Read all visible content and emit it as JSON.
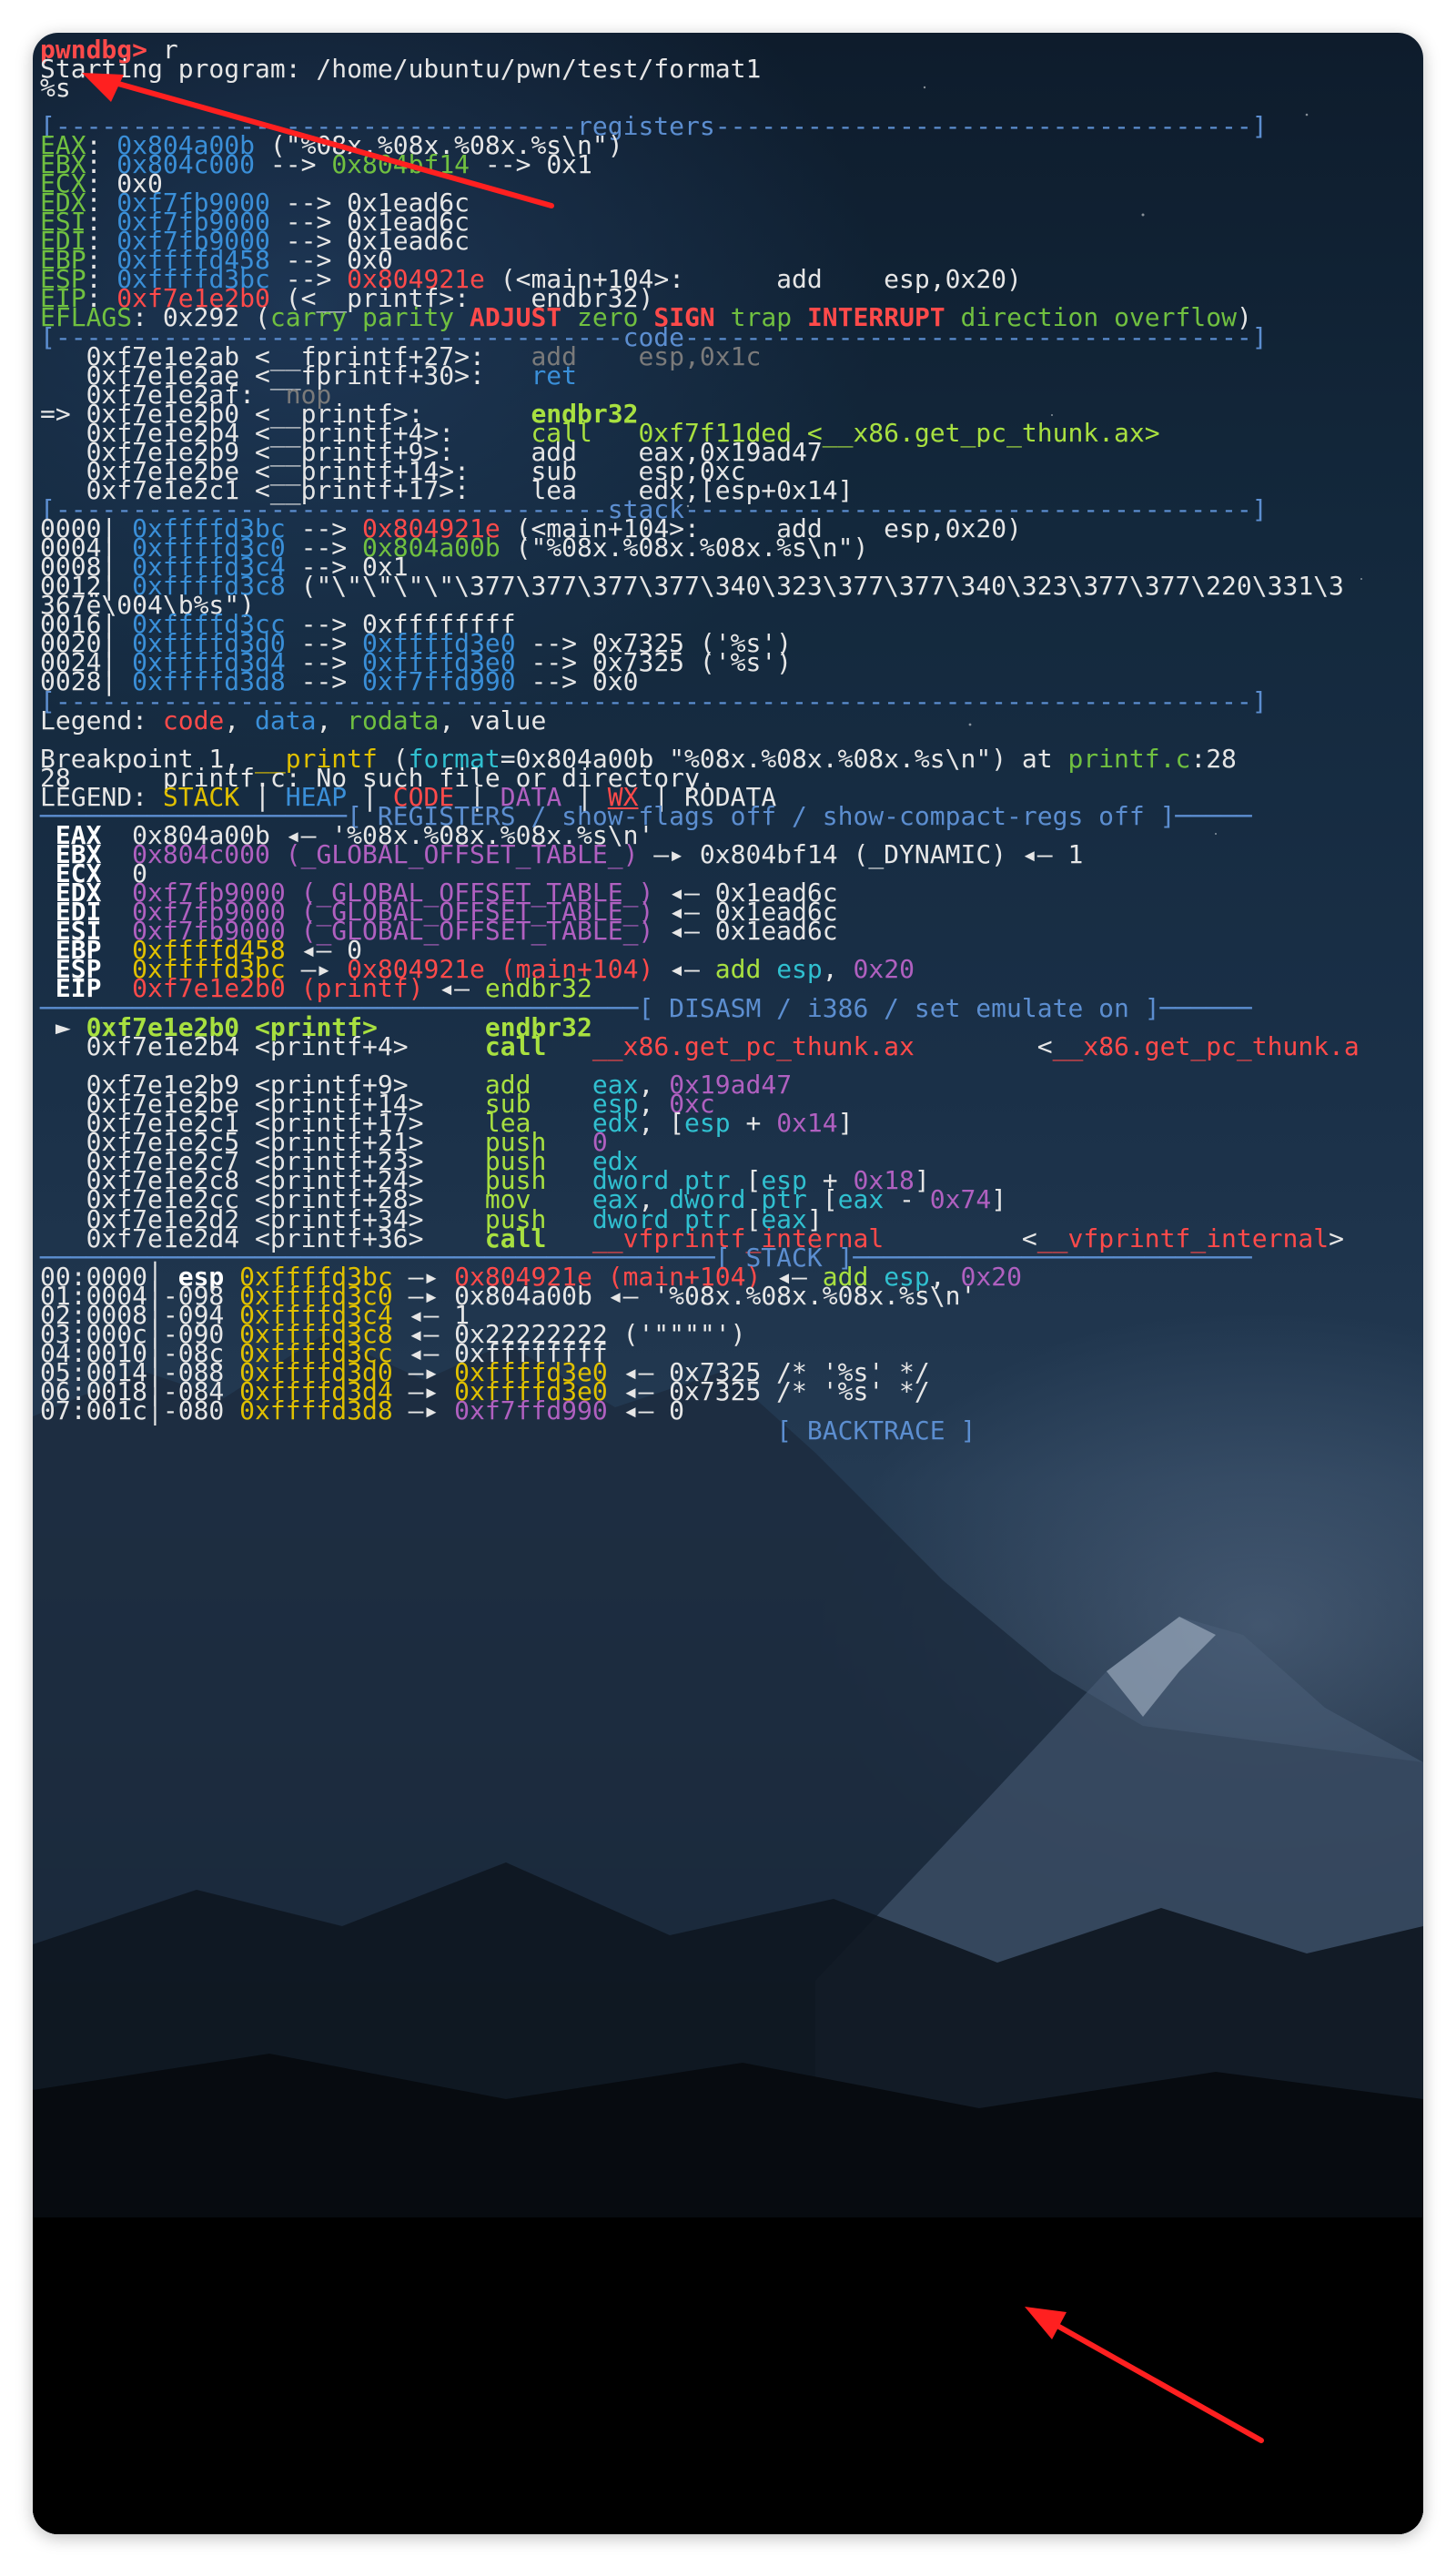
{
  "terminal": {
    "prompt": "pwndbg>",
    "command": " r",
    "starting": "Starting program: /home/ubuntu/pwn/test/format1",
    "input": "%s"
  },
  "peda": {
    "registers_header": "[----------------------------------registers-----------------------------------]",
    "registers": [
      [
        [
          "EAX",
          "g"
        ],
        [
          ": ",
          "w"
        ],
        [
          "0x804a00b",
          "b"
        ],
        [
          " (\"%08x.%08x.%08x.%s\\n\")",
          "w"
        ]
      ],
      [
        [
          "EBX",
          "g"
        ],
        [
          ": ",
          "w"
        ],
        [
          "0x804c000",
          "b"
        ],
        [
          " --> ",
          "w"
        ],
        [
          "0x804bf14",
          "g"
        ],
        [
          " --> 0x1",
          "w"
        ]
      ],
      [
        [
          "ECX",
          "g"
        ],
        [
          ": 0x0",
          "w"
        ]
      ],
      [
        [
          "EDX",
          "g"
        ],
        [
          ": ",
          "w"
        ],
        [
          "0xf7fb9000",
          "b"
        ],
        [
          " --> 0x1ead6c",
          "w"
        ]
      ],
      [
        [
          "ESI",
          "g"
        ],
        [
          ": ",
          "w"
        ],
        [
          "0xf7fb9000",
          "b"
        ],
        [
          " --> 0x1ead6c",
          "w"
        ]
      ],
      [
        [
          "EDI",
          "g"
        ],
        [
          ": ",
          "w"
        ],
        [
          "0xf7fb9000",
          "b"
        ],
        [
          " --> 0x1ead6c",
          "w"
        ]
      ],
      [
        [
          "EBP",
          "g"
        ],
        [
          ": ",
          "w"
        ],
        [
          "0xffffd458",
          "b"
        ],
        [
          " --> 0x0",
          "w"
        ]
      ],
      [
        [
          "ESP",
          "g"
        ],
        [
          ": ",
          "w"
        ],
        [
          "0xffffd3bc",
          "b"
        ],
        [
          " --> ",
          "w"
        ],
        [
          "0x804921e",
          "r"
        ],
        [
          " (<main+104>:      add    esp,0x20)",
          "w"
        ]
      ],
      [
        [
          "EIP",
          "g"
        ],
        [
          ": ",
          "w"
        ],
        [
          "0xf7e1e2b0",
          "r"
        ],
        [
          " (<__printf>:    endbr32)",
          "w"
        ]
      ],
      [
        [
          "EFLAGS",
          "g"
        ],
        [
          ": 0x292 (",
          "w"
        ],
        [
          "carry parity ",
          "g"
        ],
        [
          "ADJUST",
          "rb"
        ],
        [
          " zero ",
          "g"
        ],
        [
          "SIGN",
          "rb"
        ],
        [
          " trap ",
          "g"
        ],
        [
          "INTERRUPT",
          "rb"
        ],
        [
          " direction overflow",
          "g"
        ],
        [
          ")",
          "w"
        ]
      ]
    ],
    "code_header": "[-------------------------------------code-------------------------------------]",
    "code": [
      [
        [
          "   0xf7e1e2ab <__fprintf+27>:   ",
          "w"
        ],
        [
          "add    esp,0x1c",
          "gr"
        ]
      ],
      [
        [
          "   0xf7e1e2ae <__fprintf+30>:   ",
          "w"
        ],
        [
          "ret",
          "b"
        ]
      ],
      [
        [
          "   0xf7e1e2af:  ",
          "w"
        ],
        [
          "nop",
          "gr"
        ]
      ],
      [
        [
          "=> 0xf7e1e2b0 <__printf>:       ",
          "w"
        ],
        [
          "endbr32",
          "gb"
        ]
      ],
      [
        [
          "   0xf7e1e2b4 <__printf+4>:     ",
          "w"
        ],
        [
          "call   0xf7f11ded <__x86.get_pc_thunk.ax>",
          "gy"
        ]
      ],
      [
        [
          "   0xf7e1e2b9 <__printf+9>:     add    eax,0x19ad47",
          "w"
        ]
      ],
      [
        [
          "   0xf7e1e2be <__printf+14>:    sub    esp,0xc",
          "w"
        ]
      ],
      [
        [
          "   0xf7e1e2c1 <__printf+17>:    lea    edx,[esp+0x14]",
          "w"
        ]
      ]
    ],
    "stack_header": "[------------------------------------stack-------------------------------------]",
    "stack": [
      [
        [
          "0000| ",
          "w"
        ],
        [
          "0xffffd3bc",
          "b"
        ],
        [
          " --> ",
          "w"
        ],
        [
          "0x804921e",
          "r"
        ],
        [
          " (<main+104>:     add    esp,0x20)",
          "w"
        ]
      ],
      [
        [
          "0004| ",
          "w"
        ],
        [
          "0xffffd3c0",
          "b"
        ],
        [
          " --> ",
          "w"
        ],
        [
          "0x804a00b",
          "g"
        ],
        [
          " (\"%08x.%08x.%08x.%s\\n\")",
          "w"
        ]
      ],
      [
        [
          "0008| ",
          "w"
        ],
        [
          "0xffffd3c4",
          "b"
        ],
        [
          " --> 0x1",
          "w"
        ]
      ],
      [
        [
          "0012| ",
          "w"
        ],
        [
          "0xffffd3c8",
          "b"
        ],
        [
          " (\"\\\"\\\"\\\"\\\"\\377\\377\\377\\377\\340\\323\\377\\377\\340\\323\\377\\377\\220\\331\\3",
          "w"
        ]
      ],
      [
        [
          "367ë\\004\\b%s\")",
          "w"
        ]
      ],
      [
        [
          "0016| ",
          "w"
        ],
        [
          "0xffffd3cc",
          "b"
        ],
        [
          " --> 0xffffffff",
          "w"
        ]
      ],
      [
        [
          "0020| ",
          "w"
        ],
        [
          "0xffffd3d0",
          "b"
        ],
        [
          " --> ",
          "w"
        ],
        [
          "0xffffd3e0",
          "b"
        ],
        [
          " --> 0x7325 ('%s')",
          "w"
        ]
      ],
      [
        [
          "0024| ",
          "w"
        ],
        [
          "0xffffd3d4",
          "b"
        ],
        [
          " --> ",
          "w"
        ],
        [
          "0xffffd3e0",
          "b"
        ],
        [
          " --> 0x7325 ('%s')",
          "w"
        ]
      ],
      [
        [
          "0028| ",
          "w"
        ],
        [
          "0xffffd3d8",
          "b"
        ],
        [
          " --> ",
          "w"
        ],
        [
          "0xf7ffd990",
          "b"
        ],
        [
          " --> 0x0",
          "w"
        ]
      ]
    ],
    "footer": "[------------------------------------------------------------------------------]",
    "legend": [
      [
        "Legend: ",
        "w"
      ],
      [
        "code",
        "r"
      ],
      [
        ", ",
        "w"
      ],
      [
        "data",
        "b"
      ],
      [
        ", ",
        "w"
      ],
      [
        "rodata",
        "g"
      ],
      [
        ", value",
        "w"
      ]
    ]
  },
  "breakpoint": [
    [
      [
        "Breakpoint 1, ",
        "w"
      ],
      [
        "__printf",
        "y"
      ],
      [
        " (",
        "w"
      ],
      [
        "format",
        "c"
      ],
      [
        "=0x804a00b \"%08x.%08x.%08x.%s\\n\") at ",
        "w"
      ],
      [
        "printf.c",
        "g"
      ],
      [
        ":28",
        "w"
      ]
    ],
    [
      [
        "28      printf.c: No such file or directory.",
        "w"
      ]
    ],
    [
      [
        "LEGEND: ",
        "w"
      ],
      [
        "STACK",
        "y"
      ],
      [
        " | ",
        "w"
      ],
      [
        "HEAP",
        "b"
      ],
      [
        " | ",
        "w"
      ],
      [
        "CODE",
        "r"
      ],
      [
        " | ",
        "w"
      ],
      [
        "DATA",
        "m"
      ],
      [
        " | ",
        "w"
      ],
      [
        "WX",
        "ru"
      ],
      [
        " | RODATA",
        "w"
      ]
    ]
  ],
  "pwndbg": {
    "registers_header": "────────────────────[ REGISTERS / show-flags off / show-compact-regs off ]─────",
    "registers": [
      [
        [
          " EAX  ",
          "wb"
        ],
        [
          "0x804a00b ◂— '%08x.%08x.%08x.%s\\n'",
          "w"
        ]
      ],
      [
        [
          " EBX  ",
          "wb"
        ],
        [
          "0x804c000 (_GLOBAL_OFFSET_TABLE_)",
          "m"
        ],
        [
          " —▸ 0x804bf14 (_DYNAMIC) ◂— 1",
          "w"
        ]
      ],
      [
        [
          " ECX  ",
          "wb"
        ],
        [
          "0",
          "w"
        ]
      ],
      [
        [
          " EDX  ",
          "wb"
        ],
        [
          "0xf7fb9000 (_GLOBAL_OFFSET_TABLE_)",
          "m"
        ],
        [
          " ◂— 0x1ead6c",
          "w"
        ]
      ],
      [
        [
          " EDI  ",
          "wb"
        ],
        [
          "0xf7fb9000 (_GLOBAL_OFFSET_TABLE_)",
          "m"
        ],
        [
          " ◂— 0x1ead6c",
          "w"
        ]
      ],
      [
        [
          " ESI  ",
          "wb"
        ],
        [
          "0xf7fb9000 (_GLOBAL_OFFSET_TABLE_)",
          "m"
        ],
        [
          " ◂— 0x1ead6c",
          "w"
        ]
      ],
      [
        [
          " EBP  ",
          "wb"
        ],
        [
          "0xffffd458",
          "y"
        ],
        [
          " ◂— 0",
          "w"
        ]
      ],
      [
        [
          " ESP  ",
          "wb"
        ],
        [
          "0xffffd3bc",
          "y"
        ],
        [
          " —▸ ",
          "w"
        ],
        [
          "0x804921e (main+104)",
          "r"
        ],
        [
          " ◂— ",
          "w"
        ],
        [
          "add ",
          "gy"
        ],
        [
          "esp",
          "c"
        ],
        [
          ", ",
          "w"
        ],
        [
          "0x20",
          "m"
        ]
      ],
      [
        [
          " EIP  ",
          "wb"
        ],
        [
          "0xf7e1e2b0 (printf)",
          "r"
        ],
        [
          " ◂— ",
          "w"
        ],
        [
          "endbr32",
          "gy"
        ]
      ]
    ],
    "disasm_header": "───────────────────────────────────────[ DISASM / i386 / set emulate on ]──────",
    "disasm": [
      [
        [
          " ► ",
          "w"
        ],
        [
          "0xf7e1e2b0 <printf>       ",
          "gb"
        ],
        [
          "endbr32",
          "gb"
        ]
      ],
      [
        [
          "   0xf7e1e2b4 <printf+4>     ",
          "w"
        ],
        [
          "call",
          "gb"
        ],
        [
          "   ",
          "w"
        ],
        [
          "__x86.get_pc_thunk.ax",
          "r"
        ],
        [
          "        <",
          "w"
        ],
        [
          "__x86.get_pc_thunk.a",
          "r"
        ]
      ],
      [
        [
          "",
          "w"
        ]
      ],
      [
        [
          "   0xf7e1e2b9 <printf+9>     ",
          "w"
        ],
        [
          "add",
          "gy"
        ],
        [
          "    ",
          "w"
        ],
        [
          "eax",
          "c"
        ],
        [
          ", ",
          "w"
        ],
        [
          "0x19ad47",
          "m"
        ]
      ],
      [
        [
          "   0xf7e1e2be <printf+14>    ",
          "w"
        ],
        [
          "sub",
          "gy"
        ],
        [
          "    ",
          "w"
        ],
        [
          "esp",
          "c"
        ],
        [
          ", ",
          "w"
        ],
        [
          "0xc",
          "m"
        ]
      ],
      [
        [
          "   0xf7e1e2c1 <printf+17>    ",
          "w"
        ],
        [
          "lea",
          "gy"
        ],
        [
          "    ",
          "w"
        ],
        [
          "edx",
          "c"
        ],
        [
          ", [",
          "w"
        ],
        [
          "esp",
          "c"
        ],
        [
          " + ",
          "w"
        ],
        [
          "0x14",
          "m"
        ],
        [
          "]",
          "w"
        ]
      ],
      [
        [
          "   0xf7e1e2c5 <printf+21>    ",
          "w"
        ],
        [
          "push",
          "gy"
        ],
        [
          "   ",
          "w"
        ],
        [
          "0",
          "m"
        ]
      ],
      [
        [
          "   0xf7e1e2c7 <printf+23>    ",
          "w"
        ],
        [
          "push",
          "gy"
        ],
        [
          "   ",
          "w"
        ],
        [
          "edx",
          "c"
        ]
      ],
      [
        [
          "   0xf7e1e2c8 <printf+24>    ",
          "w"
        ],
        [
          "push",
          "gy"
        ],
        [
          "   ",
          "w"
        ],
        [
          "dword ptr",
          "c"
        ],
        [
          " [",
          "w"
        ],
        [
          "esp",
          "c"
        ],
        [
          " + ",
          "w"
        ],
        [
          "0x18",
          "m"
        ],
        [
          "]",
          "w"
        ]
      ],
      [
        [
          "   0xf7e1e2cc <printf+28>    ",
          "w"
        ],
        [
          "mov",
          "gy"
        ],
        [
          "    ",
          "w"
        ],
        [
          "eax",
          "c"
        ],
        [
          ", ",
          "w"
        ],
        [
          "dword ptr",
          "c"
        ],
        [
          " [",
          "w"
        ],
        [
          "eax",
          "c"
        ],
        [
          " - ",
          "w"
        ],
        [
          "0x74",
          "m"
        ],
        [
          "]",
          "w"
        ]
      ],
      [
        [
          "   0xf7e1e2d2 <printf+34>    ",
          "w"
        ],
        [
          "push",
          "gy"
        ],
        [
          "   ",
          "w"
        ],
        [
          "dword ptr",
          "c"
        ],
        [
          " [",
          "w"
        ],
        [
          "eax",
          "c"
        ],
        [
          "]",
          "w"
        ]
      ],
      [
        [
          "   0xf7e1e2d4 <printf+36>    ",
          "w"
        ],
        [
          "call",
          "gb"
        ],
        [
          "   ",
          "w"
        ],
        [
          "__vfprintf_internal",
          "r"
        ],
        [
          "         <",
          "w"
        ],
        [
          "__vfprintf_internal",
          "r"
        ],
        [
          ">",
          "w"
        ]
      ]
    ],
    "stack_header": "────────────────────────────────────────────[ STACK ]──────────────────────────",
    "stack": [
      [
        [
          "00:0000│ ",
          "w"
        ],
        [
          "esp ",
          "wb"
        ],
        [
          "0xffffd3bc",
          "y"
        ],
        [
          " —▸ ",
          "w"
        ],
        [
          "0x804921e (main+104)",
          "r"
        ],
        [
          " ◂— ",
          "w"
        ],
        [
          "add ",
          "gy"
        ],
        [
          "esp",
          "c"
        ],
        [
          ", ",
          "w"
        ],
        [
          "0x20",
          "m"
        ]
      ],
      [
        [
          "01:0004│-098 ",
          "w"
        ],
        [
          "0xffffd3c0",
          "y"
        ],
        [
          " —▸ 0x804a00b ◂— '%08x.%08x.%08x.%s\\n'",
          "w"
        ]
      ],
      [
        [
          "02:0008│-094 ",
          "w"
        ],
        [
          "0xffffd3c4",
          "y"
        ],
        [
          " ◂— 1",
          "w"
        ]
      ],
      [
        [
          "03:000c│-090 ",
          "w"
        ],
        [
          "0xffffd3c8",
          "y"
        ],
        [
          " ◂— 0x22222222 ('\"\"\"\"')",
          "w"
        ]
      ],
      [
        [
          "04:0010│-08c ",
          "w"
        ],
        [
          "0xffffd3cc",
          "y"
        ],
        [
          " ◂— 0xffffffff",
          "w"
        ]
      ],
      [
        [
          "05:0014│-088 ",
          "w"
        ],
        [
          "0xffffd3d0",
          "y"
        ],
        [
          " —▸ ",
          "w"
        ],
        [
          "0xffffd3e0",
          "y"
        ],
        [
          " ◂— 0x7325 /* '%s' */",
          "w"
        ]
      ],
      [
        [
          "06:0018│-084 ",
          "w"
        ],
        [
          "0xffffd3d4",
          "y"
        ],
        [
          " —▸ ",
          "w"
        ],
        [
          "0xffffd3e0",
          "y"
        ],
        [
          " ◂— 0x7325 /* '%s' */",
          "w"
        ]
      ],
      [
        [
          "07:001c│-080 ",
          "w"
        ],
        [
          "0xffffd3d8",
          "y"
        ],
        [
          " —▸ ",
          "w"
        ],
        [
          "0xf7ffd990",
          "m"
        ],
        [
          " ◂— 0",
          "w"
        ]
      ]
    ],
    "backtrace_header": "                                                [ BACKTRACE ]"
  },
  "colors": {
    "green": "#70c040",
    "blue": "#3a8fd8",
    "red": "#ff4a4a",
    "yellow": "#e0c000",
    "magenta": "#b060c0",
    "cyan": "#30c0d0",
    "arrow": "#ff2020"
  }
}
